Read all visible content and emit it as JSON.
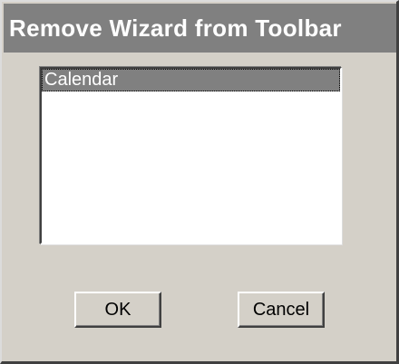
{
  "dialog": {
    "title": "Remove Wizard from Toolbar"
  },
  "wizard_list": {
    "items": [
      {
        "label": "Calendar",
        "selected": true
      }
    ]
  },
  "buttons": {
    "ok_label": "OK",
    "cancel_label": "Cancel"
  },
  "colors": {
    "face": "#d4d0c8",
    "titlebar_inactive": "#808080",
    "selection": "#808080",
    "list_bg": "#ffffff"
  }
}
